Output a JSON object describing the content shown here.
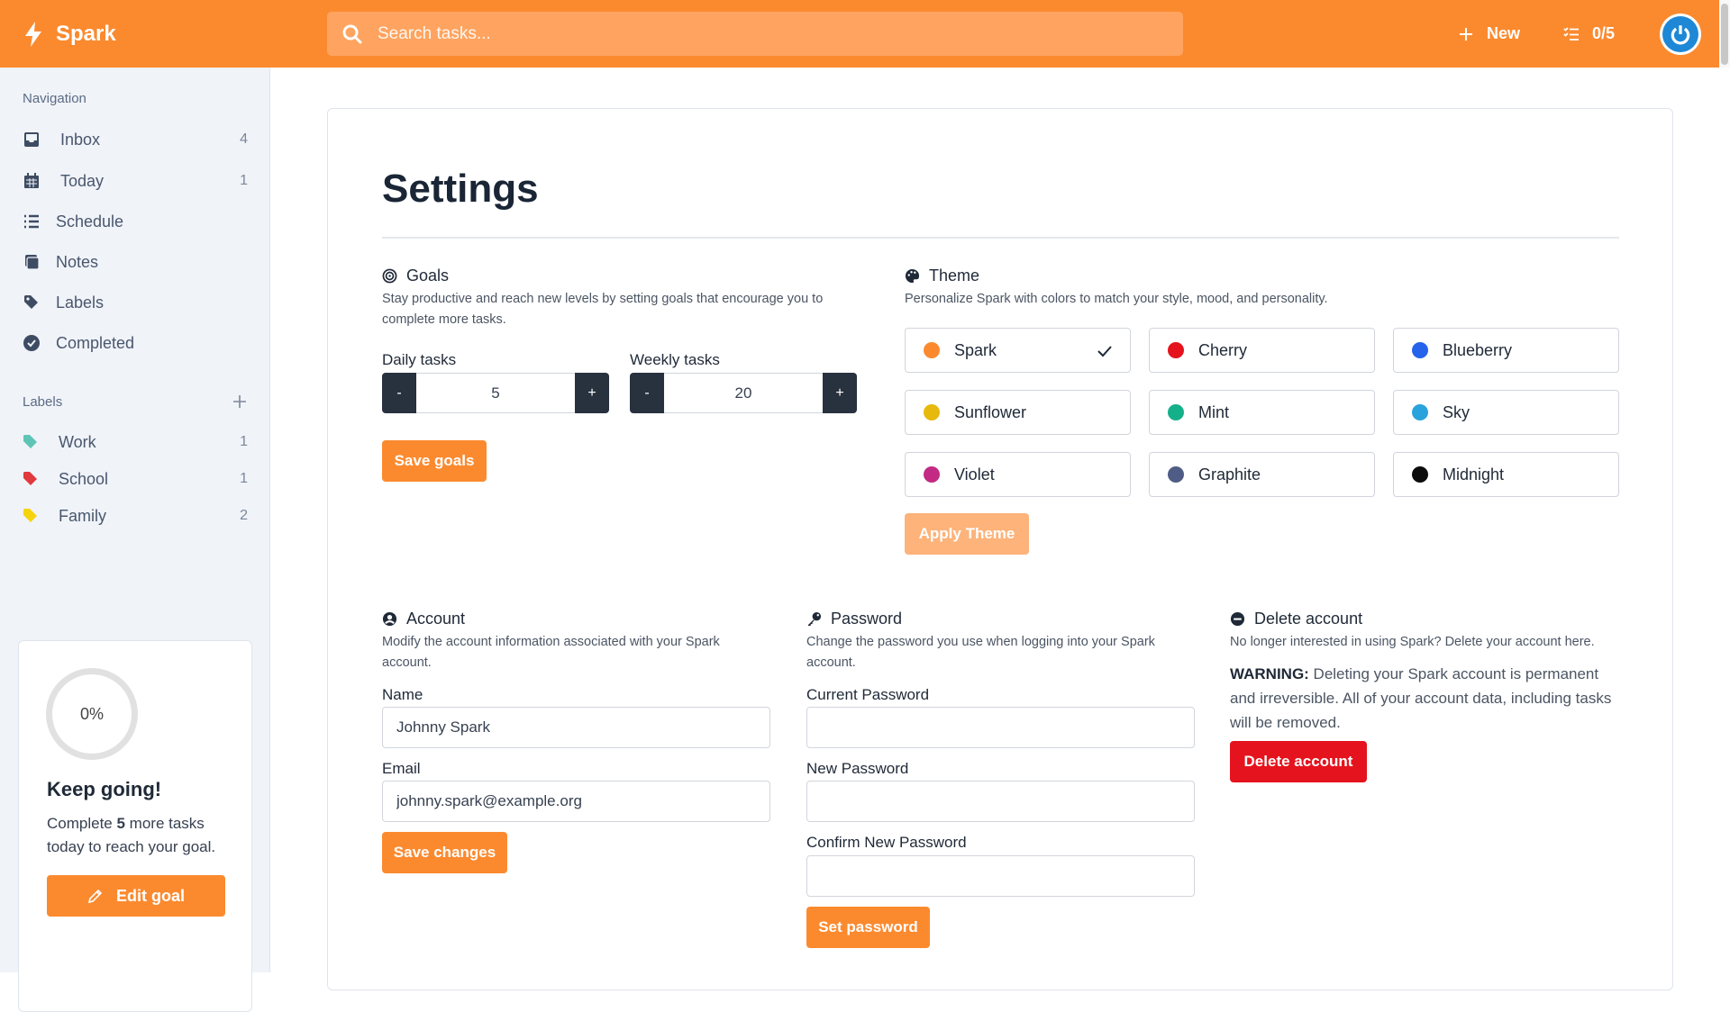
{
  "app": {
    "name": "Spark"
  },
  "search": {
    "placeholder": "Search tasks..."
  },
  "topbar": {
    "new_label": "New",
    "progress": "0/5"
  },
  "sidebar": {
    "nav_heading": "Navigation",
    "nav": [
      {
        "label": "Inbox",
        "count": "4",
        "icon": "inbox-icon"
      },
      {
        "label": "Today",
        "count": "1",
        "icon": "calendar-icon"
      },
      {
        "label": "Schedule",
        "count": "",
        "icon": "list-icon"
      },
      {
        "label": "Notes",
        "count": "",
        "icon": "notes-icon"
      },
      {
        "label": "Labels",
        "count": "",
        "icon": "tags-icon"
      },
      {
        "label": "Completed",
        "count": "",
        "icon": "check-circle-icon"
      }
    ],
    "labels_heading": "Labels",
    "labels": [
      {
        "label": "Work",
        "count": "1",
        "color": "#5ec5b6"
      },
      {
        "label": "School",
        "count": "1",
        "color": "#e0393e"
      },
      {
        "label": "Family",
        "count": "2",
        "color": "#f5d40f"
      }
    ],
    "goal_card": {
      "percent": "0%",
      "title": "Keep going!",
      "text_pre": "Complete ",
      "remaining": "5",
      "text_post": " more tasks today to reach your goal.",
      "button": "Edit goal"
    }
  },
  "settings": {
    "title": "Settings",
    "goals": {
      "heading": "Goals",
      "description": "Stay productive and reach new levels by setting goals that encourage you to complete more tasks.",
      "daily_label": "Daily tasks",
      "daily_value": "5",
      "weekly_label": "Weekly tasks",
      "weekly_value": "20",
      "minus": "-",
      "plus": "+",
      "save": "Save goals"
    },
    "theme": {
      "heading": "Theme",
      "description": "Personalize Spark with colors to match your style, mood, and personality.",
      "options": [
        {
          "name": "Spark",
          "color": "#fb8a2f",
          "selected": true
        },
        {
          "name": "Cherry",
          "color": "#e5131d"
        },
        {
          "name": "Blueberry",
          "color": "#2563eb"
        },
        {
          "name": "Sunflower",
          "color": "#e7b90c"
        },
        {
          "name": "Mint",
          "color": "#14b08a"
        },
        {
          "name": "Sky",
          "color": "#2aa3dd"
        },
        {
          "name": "Violet",
          "color": "#c32a83"
        },
        {
          "name": "Graphite",
          "color": "#4f5d86"
        },
        {
          "name": "Midnight",
          "color": "#0c0c0c"
        }
      ],
      "apply": "Apply Theme"
    },
    "account": {
      "heading": "Account",
      "description": "Modify the account information associated with your Spark account.",
      "name_label": "Name",
      "name_value": "Johnny Spark",
      "email_label": "Email",
      "email_value": "johnny.spark@example.org",
      "save": "Save changes"
    },
    "password": {
      "heading": "Password",
      "description": "Change the password you use when logging into your Spark account.",
      "current_label": "Current Password",
      "new_label": "New Password",
      "confirm_label": "Confirm New Password",
      "set": "Set password"
    },
    "delete": {
      "heading": "Delete account",
      "description": "No longer interested in using Spark? Delete your account here.",
      "warning_strong": "WARNING:",
      "warning_text": " Deleting your Spark account is permanent and irreversible. All of your account data, including tasks will be removed.",
      "button": "Delete account"
    }
  }
}
